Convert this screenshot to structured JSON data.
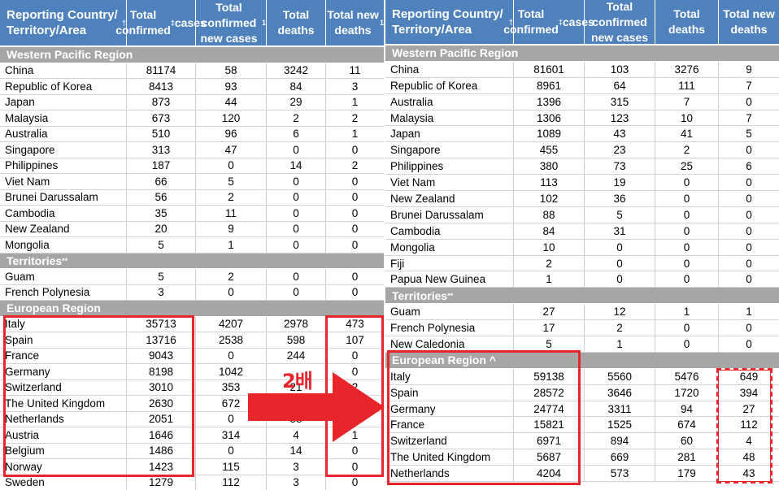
{
  "left": {
    "header": [
      "Reporting Country/ Territory/Area†",
      "Total confirmed ‡ cases",
      "Total confirmed new cases§",
      "Total deaths",
      "Total new deaths§"
    ],
    "sections": [
      {
        "title": "Western Pacific Region",
        "rows": [
          [
            "China",
            "81174",
            "58",
            "3242",
            "11"
          ],
          [
            "Republic of Korea",
            "8413",
            "93",
            "84",
            "3"
          ],
          [
            "Japan",
            "873",
            "44",
            "29",
            "1"
          ],
          [
            "Malaysia",
            "673",
            "120",
            "2",
            "2"
          ],
          [
            "Australia",
            "510",
            "96",
            "6",
            "1"
          ],
          [
            "Singapore",
            "313",
            "47",
            "0",
            "0"
          ],
          [
            "Philippines",
            "187",
            "0",
            "14",
            "2"
          ],
          [
            "Viet Nam",
            "66",
            "5",
            "0",
            "0"
          ],
          [
            "Brunei Darussalam",
            "56",
            "2",
            "0",
            "0"
          ],
          [
            "Cambodia",
            "35",
            "11",
            "0",
            "0"
          ],
          [
            "New Zealand",
            "20",
            "9",
            "0",
            "0"
          ],
          [
            "Mongolia",
            "5",
            "1",
            "0",
            "0"
          ]
        ]
      },
      {
        "title": "Territories**",
        "rows": [
          [
            "Guam",
            "5",
            "2",
            "0",
            "0"
          ],
          [
            "French Polynesia",
            "3",
            "0",
            "0",
            "0"
          ]
        ]
      },
      {
        "title": "European Region",
        "rows": [
          [
            "Italy",
            "35713",
            "4207",
            "2978",
            "473"
          ],
          [
            "Spain",
            "13716",
            "2538",
            "598",
            "107"
          ],
          [
            "France",
            "9043",
            "0",
            "244",
            "0"
          ],
          [
            "Germany",
            "8198",
            "1042",
            "",
            "0"
          ],
          [
            "Switzerland",
            "3010",
            "353",
            "21",
            "2"
          ],
          [
            "The United Kingdom",
            "2630",
            "672",
            "",
            "0"
          ],
          [
            "Netherlands",
            "2051",
            "0",
            "58",
            "0"
          ],
          [
            "Austria",
            "1646",
            "314",
            "4",
            "1"
          ],
          [
            "Belgium",
            "1486",
            "0",
            "14",
            "0"
          ],
          [
            "Norway",
            "1423",
            "115",
            "3",
            "0"
          ],
          [
            "Sweden",
            "1279",
            "112",
            "3",
            "0"
          ]
        ]
      }
    ]
  },
  "right": {
    "header": [
      "Reporting Country/ Territory/Area†",
      "Total confirmed ‡ cases",
      "Total confirmed new cases",
      "Total deaths",
      "Total new deaths"
    ],
    "sections": [
      {
        "title": "Western Pacific Region",
        "rows": [
          [
            "China",
            "81601",
            "103",
            "3276",
            "9"
          ],
          [
            "Republic of Korea",
            "8961",
            "64",
            "111",
            "7"
          ],
          [
            "Australia",
            "1396",
            "315",
            "7",
            "0"
          ],
          [
            "Malaysia",
            "1306",
            "123",
            "10",
            "7"
          ],
          [
            "Japan",
            "1089",
            "43",
            "41",
            "5"
          ],
          [
            "Singapore",
            "455",
            "23",
            "2",
            "0"
          ],
          [
            "Philippines",
            "380",
            "73",
            "25",
            "6"
          ],
          [
            "Viet Nam",
            "113",
            "19",
            "0",
            "0"
          ],
          [
            "New Zealand",
            "102",
            "36",
            "0",
            "0"
          ],
          [
            "Brunei Darussalam",
            "88",
            "5",
            "0",
            "0"
          ],
          [
            "Cambodia",
            "84",
            "31",
            "0",
            "0"
          ],
          [
            "Mongolia",
            "10",
            "0",
            "0",
            "0"
          ],
          [
            "Fiji",
            "2",
            "0",
            "0",
            "0"
          ],
          [
            "Papua New Guinea",
            "1",
            "0",
            "0",
            "0"
          ]
        ]
      },
      {
        "title": "Territories**",
        "rows": [
          [
            "Guam",
            "27",
            "12",
            "1",
            "1"
          ],
          [
            "French Polynesia",
            "17",
            "2",
            "0",
            "0"
          ],
          [
            "New Caledonia",
            "5",
            "1",
            "0",
            "0"
          ]
        ]
      },
      {
        "title": "European Region ^",
        "rows": [
          [
            "Italy",
            "59138",
            "5560",
            "5476",
            "649"
          ],
          [
            "Spain",
            "28572",
            "3646",
            "1720",
            "394"
          ],
          [
            "Germany",
            "24774",
            "3311",
            "94",
            "27"
          ],
          [
            "France",
            "15821",
            "1525",
            "674",
            "112"
          ],
          [
            "Switzerland",
            "6971",
            "894",
            "60",
            "4"
          ],
          [
            "The United Kingdom",
            "5687",
            "669",
            "281",
            "48"
          ],
          [
            "Netherlands",
            "4204",
            "573",
            "179",
            "43"
          ]
        ]
      }
    ]
  },
  "annotation": {
    "text": "2배",
    "color": "#e8252b"
  },
  "colors": {
    "header": "#4f81bd",
    "section": "#a6a6a6",
    "highlight": "#e8252b"
  }
}
